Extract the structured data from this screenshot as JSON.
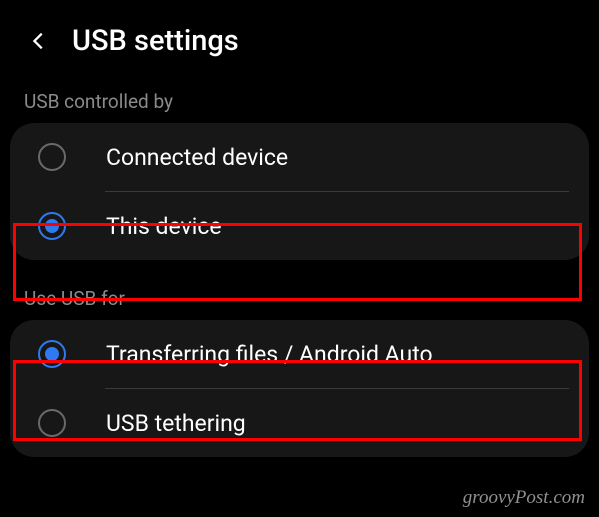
{
  "header": {
    "title": "USB settings"
  },
  "sections": {
    "controlled_by": {
      "label": "USB controlled by",
      "options": {
        "connected_device": "Connected device",
        "this_device": "This device"
      }
    },
    "use_for": {
      "label": "Use USB for",
      "options": {
        "transferring_files": "Transferring files / Android Auto",
        "usb_tethering": "USB tethering"
      }
    }
  },
  "watermark": "groovyPost.com"
}
